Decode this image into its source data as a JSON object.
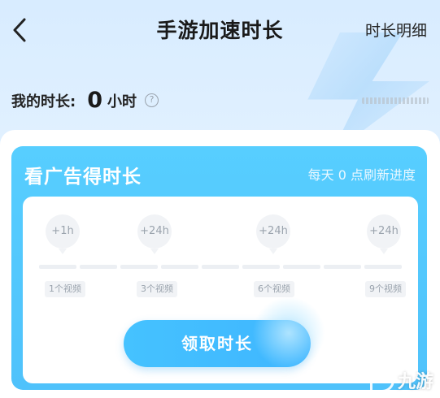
{
  "header": {
    "title": "手游加速时长",
    "detail_label": "时长明细"
  },
  "balance": {
    "label": "我的时长:",
    "value": "0",
    "unit": "小时",
    "help": "?"
  },
  "ad_card": {
    "title": "看广告得时长",
    "subtitle": "每天 0 点刷新进度",
    "milestones": [
      {
        "reward": "+1h",
        "videos": "1个视频"
      },
      {
        "reward": "+24h",
        "videos": "3个视频"
      },
      {
        "reward": "+24h",
        "videos": "6个视频"
      },
      {
        "reward": "+24h",
        "videos": "9个视频"
      }
    ],
    "progress_fraction": 0,
    "claim_label": "领取时长"
  },
  "watermark": {
    "text": "九游"
  },
  "colors": {
    "accent": "#4fc2fb",
    "background": "#dcefff"
  }
}
